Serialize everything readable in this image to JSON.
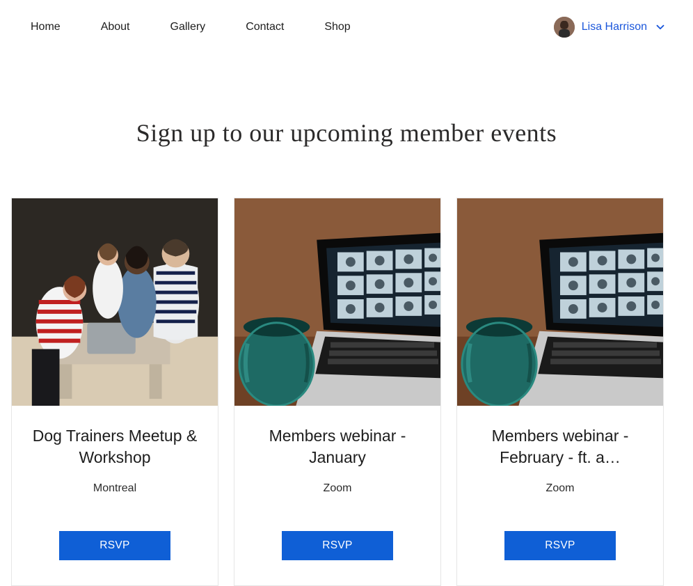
{
  "nav": {
    "items": [
      "Home",
      "About",
      "Gallery",
      "Contact",
      "Shop"
    ]
  },
  "account": {
    "username": "Lisa Harrison"
  },
  "page": {
    "title": "Sign up to our upcoming member events"
  },
  "events": [
    {
      "title": "Dog Trainers Meetup & Workshop",
      "location": "Montreal",
      "cta": "RSVP",
      "image": "workshop"
    },
    {
      "title": "Members webinar - January",
      "location": "Zoom",
      "cta": "RSVP",
      "image": "webinar"
    },
    {
      "title": "Members webinar - February - ft. a…",
      "location": "Zoom",
      "cta": "RSVP",
      "image": "webinar"
    }
  ]
}
